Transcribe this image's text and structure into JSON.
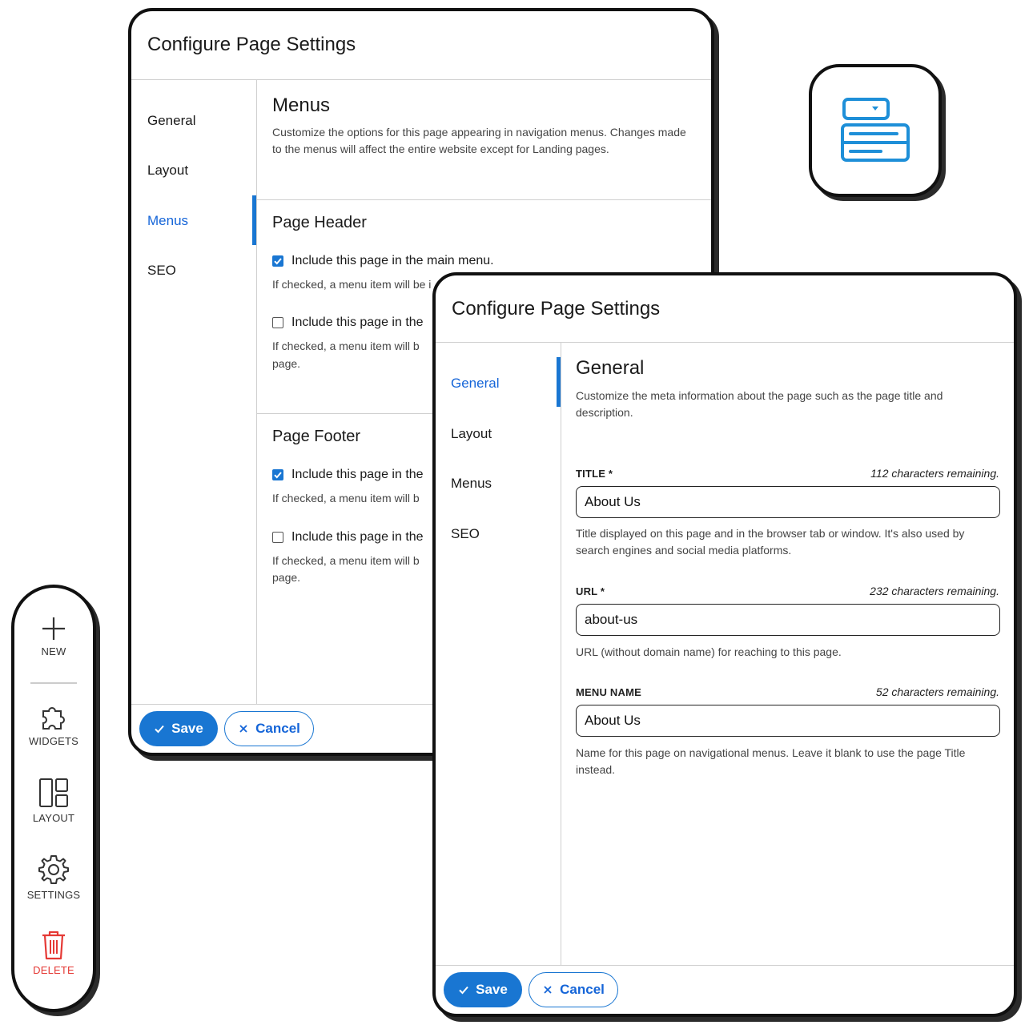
{
  "back_panel": {
    "title": "Configure Page Settings",
    "nav": [
      "General",
      "Layout",
      "Menus",
      "SEO"
    ],
    "active_nav": "Menus",
    "section_title": "Menus",
    "section_desc": "Customize the options for this page appearing in navigation menus. Changes made to the menus will affect the entire website except for Landing pages.",
    "header": {
      "title": "Page Header",
      "options": [
        {
          "label": "Include this page in the main menu.",
          "checked": true,
          "help": "If checked, a menu item will be i"
        },
        {
          "label": "Include this page in the",
          "checked": false,
          "help": "If checked, a menu item will b",
          "help2": "page."
        }
      ]
    },
    "footer": {
      "title": "Page Footer",
      "options": [
        {
          "label": "Include this page in the",
          "checked": true,
          "help": "If checked, a menu item will b"
        },
        {
          "label": "Include this page in the",
          "checked": false,
          "help": "If checked, a menu item will b",
          "help2": "page."
        }
      ]
    },
    "save_label": "Save",
    "cancel_label": "Cancel"
  },
  "front_panel": {
    "title": "Configure Page Settings",
    "nav": [
      "General",
      "Layout",
      "Menus",
      "SEO"
    ],
    "active_nav": "General",
    "section_title": "General",
    "section_desc": "Customize the meta information about the page such as the page title and description.",
    "fields": [
      {
        "label": "TITLE *",
        "remaining": "112 characters remaining.",
        "value": "About Us",
        "help": "Title displayed on this page and in the browser tab or window. It's also used by search engines and social media platforms."
      },
      {
        "label": "URL *",
        "remaining": "232 characters remaining.",
        "value": "about-us",
        "help": "URL (without domain name) for reaching to this page."
      },
      {
        "label": "MENU NAME",
        "remaining": "52 characters remaining.",
        "value": "About Us",
        "help": "Name for this page on navigational menus. Leave it blank to use the page Title instead."
      }
    ],
    "save_label": "Save",
    "cancel_label": "Cancel"
  },
  "toolbar": {
    "new": "NEW",
    "widgets": "WIDGETS",
    "layout": "LAYOUT",
    "settings": "SETTINGS",
    "delete": "DELETE"
  },
  "colors": {
    "accent": "#1976d2",
    "danger": "#e53935",
    "icon_blue": "#1e8fd8"
  },
  "icons": {
    "app": "page-menu-icon",
    "new": "plus-icon",
    "widgets": "puzzle-icon",
    "layout": "layout-icon",
    "settings": "gear-icon",
    "delete": "trash-icon"
  }
}
